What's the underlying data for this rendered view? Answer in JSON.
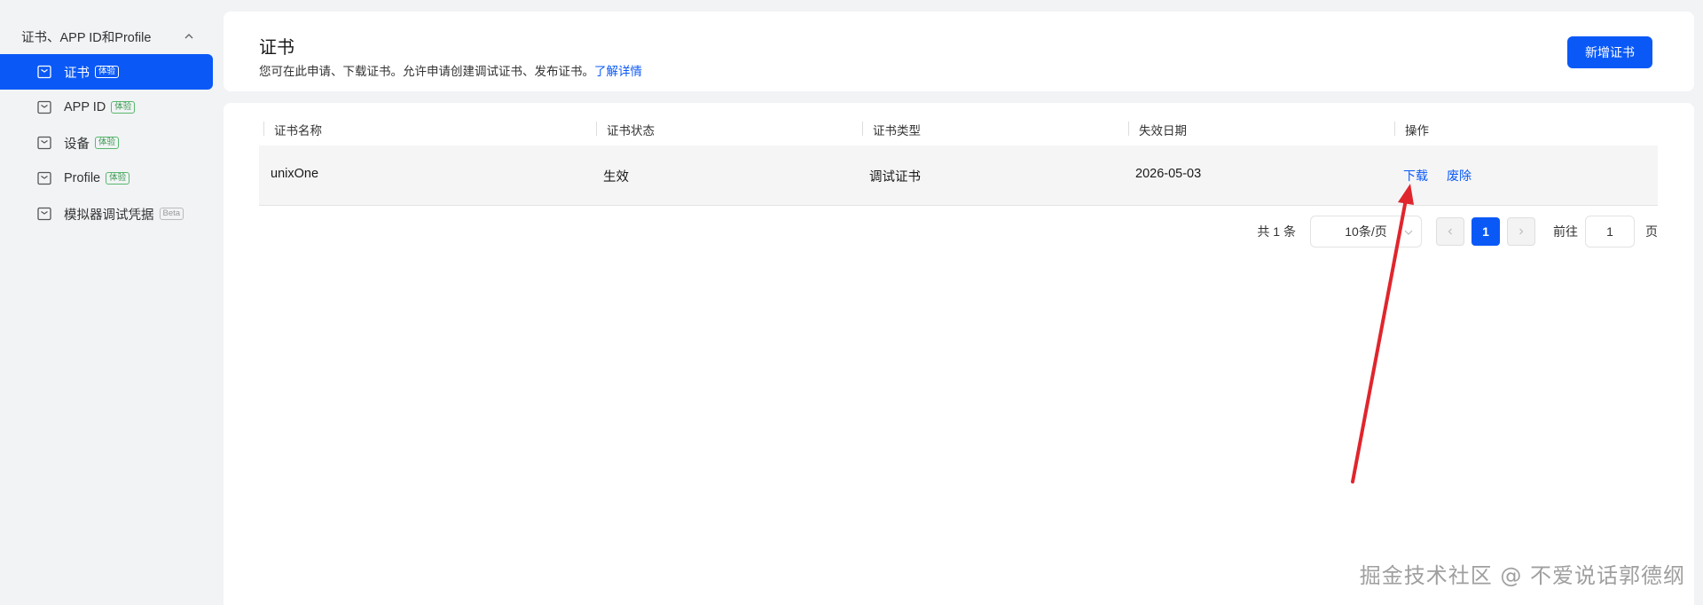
{
  "sidebar": {
    "group_label": "证书、APP ID和Profile",
    "items": [
      {
        "label": "证书",
        "badge": "体验",
        "active": true
      },
      {
        "label": "APP ID",
        "badge": "体验",
        "active": false
      },
      {
        "label": "设备",
        "badge": "体验",
        "active": false
      },
      {
        "label": "Profile",
        "badge": "体验",
        "active": false
      },
      {
        "label": "模拟器调试凭据",
        "badge": "Beta",
        "active": false
      }
    ]
  },
  "header": {
    "title": "证书",
    "description": "您可在此申请、下载证书。允许申请创建调试证书、发布证书。",
    "learn_more": "了解详情",
    "new_button": "新增证书"
  },
  "table": {
    "columns": [
      "证书名称",
      "证书状态",
      "证书类型",
      "失效日期",
      "操作"
    ],
    "rows": [
      {
        "name": "unixOne",
        "status": "生效",
        "type": "调试证书",
        "expiry": "2026-05-03",
        "actions": [
          "下载",
          "废除"
        ]
      }
    ]
  },
  "pagination": {
    "total_text": "共 1 条",
    "page_size": "10条/页",
    "current_page": "1",
    "goto_label": "前往",
    "goto_value": "1",
    "goto_unit": "页"
  },
  "watermark": "掘金技术社区 @ 不爱说话郭德纲",
  "colors": {
    "accent": "#0a59f7",
    "annotation_arrow": "#e0252d",
    "badge_green": "#3d9a52"
  },
  "icons": {
    "sidebar_item": "certificate-doc-icon",
    "group_toggle": "chevron-up-icon"
  }
}
